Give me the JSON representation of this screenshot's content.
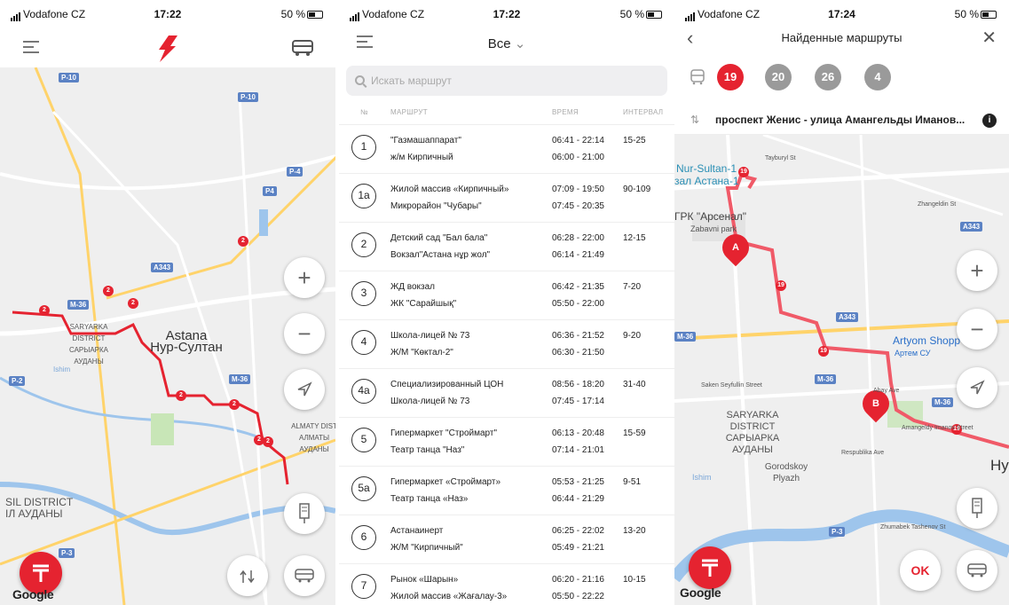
{
  "status1": {
    "carrier": "Vodafone CZ",
    "time": "17:22",
    "battery": "50 %"
  },
  "status2": {
    "carrier": "Vodafone CZ",
    "time": "17:22",
    "battery": "50 %"
  },
  "status3": {
    "carrier": "Vodafone CZ",
    "time": "17:24",
    "battery": "50 %"
  },
  "map1": {
    "city_label_1": "Astana",
    "city_label_2": "Нур-Султан",
    "district_1": "SARYARKA DISTRICT САРЫАРКА АУДАНЫ",
    "district_2": "ALMATY DIST АЛМАТЫ АУДАНЫ",
    "district_3": "SIL DISTRICT ІЛ АУДАНЫ",
    "river": "Ishim",
    "road_tags": [
      "P-10",
      "P-10",
      "P-4",
      "P4",
      "A343",
      "M-36",
      "M-36",
      "P-2",
      "P-3"
    ],
    "stop_badge": "2",
    "google": "Google"
  },
  "list": {
    "filter": "Все",
    "search_placeholder": "Искать маршрут",
    "columns": {
      "num": "№",
      "route": "МАРШРУТ",
      "time": "ВРЕМЯ",
      "interval": "ИНТЕРВАЛ"
    },
    "rows": [
      {
        "num": "1",
        "from": "\"Газмашаппарат\"",
        "to": "ж/м Кирпичный",
        "t1": "06:41 - 22:14",
        "t2": "06:00 - 21:00",
        "interval": "15-25"
      },
      {
        "num": "1a",
        "from": "Жилой массив «Кирпичный»",
        "to": "Микрорайон \"Чубары\"",
        "t1": "07:09 - 19:50",
        "t2": "07:45 - 20:35",
        "interval": "90-109"
      },
      {
        "num": "2",
        "from": "Детский сад \"Бал бала\"",
        "to": "Вокзал\"Астана нұр жол\"",
        "t1": "06:28 - 22:00",
        "t2": "06:14 - 21:49",
        "interval": "12-15"
      },
      {
        "num": "3",
        "from": "ЖД вокзал",
        "to": "ЖК \"Сарайшық\"",
        "t1": "06:42 - 21:35",
        "t2": "05:50 - 22:00",
        "interval": "7-20"
      },
      {
        "num": "4",
        "from": "Школа-лицей № 73",
        "to": "Ж/М \"Көктал-2\"",
        "t1": "06:36 - 21:52",
        "t2": "06:30 - 21:50",
        "interval": "9-20"
      },
      {
        "num": "4a",
        "from": "Специализированный ЦОН",
        "to": "Школа-лицей № 73",
        "t1": "08:56 - 18:20",
        "t2": "07:45 - 17:14",
        "interval": "31-40"
      },
      {
        "num": "5",
        "from": "Гипермаркет \"Строймарт\"",
        "to": "Театр танца \"Наз\"",
        "t1": "06:13 - 20:48",
        "t2": "07:14 - 21:01",
        "interval": "15-59"
      },
      {
        "num": "5a",
        "from": "Гипермаркет «Строймарт»",
        "to": "Театр танца «Наз»",
        "t1": "05:53 - 21:25",
        "t2": "06:44 - 21:29",
        "interval": "9-51"
      },
      {
        "num": "6",
        "from": "Астанаинерт",
        "to": "Ж/М \"Кирпичный\"",
        "t1": "06:25 - 22:02",
        "t2": "05:49 - 21:21",
        "interval": "13-20"
      },
      {
        "num": "7",
        "from": "Рынок «Шарын»",
        "to": "Жилой массив «Жағалау-3»",
        "t1": "06:20 - 21:16",
        "t2": "05:50 - 22:22",
        "interval": "10-15"
      }
    ]
  },
  "found": {
    "title": "Найденные маршруты",
    "chips": [
      "19",
      "20",
      "26",
      "4"
    ],
    "route_name": "проспект Женис - улица Амангельды Иманов...",
    "info": "i",
    "ok": "OK",
    "google": "Google",
    "labels": {
      "nur1": "Nur-Sultan-1",
      "astana1": "зал Астана-1",
      "arsenal": "ГРК \"Арсенал\"",
      "zabavni": "Zabavni park",
      "artyom": "Artyom Shopp",
      "artyom_ru": "Артем СУ",
      "district": "SARYARKA DISTRICT САРЫАРКА АУДАНЫ",
      "gorodskoy": "Gorodskoy Plyazh",
      "ishim": "Ishim",
      "marker_a": "A",
      "marker_b": "B",
      "nu": "Ну",
      "tayburyl": "Tayburyl St",
      "zhangeldin": "Zhangeldin St",
      "saken": "Saken Seyfullin Street",
      "abay": "Abay Ave",
      "amangeldy": "Amangeldy Imanov Street",
      "respublika": "Respublika Ave",
      "zhumabek": "Zhumabek Tashenov St",
      "road_tags": [
        "A343",
        "A343",
        "M-36",
        "M-36",
        "M-36",
        "P-3"
      ],
      "stop": "19"
    }
  },
  "colors": {
    "accent": "#e52330",
    "route": "#f05a68",
    "map": "#efefef"
  }
}
